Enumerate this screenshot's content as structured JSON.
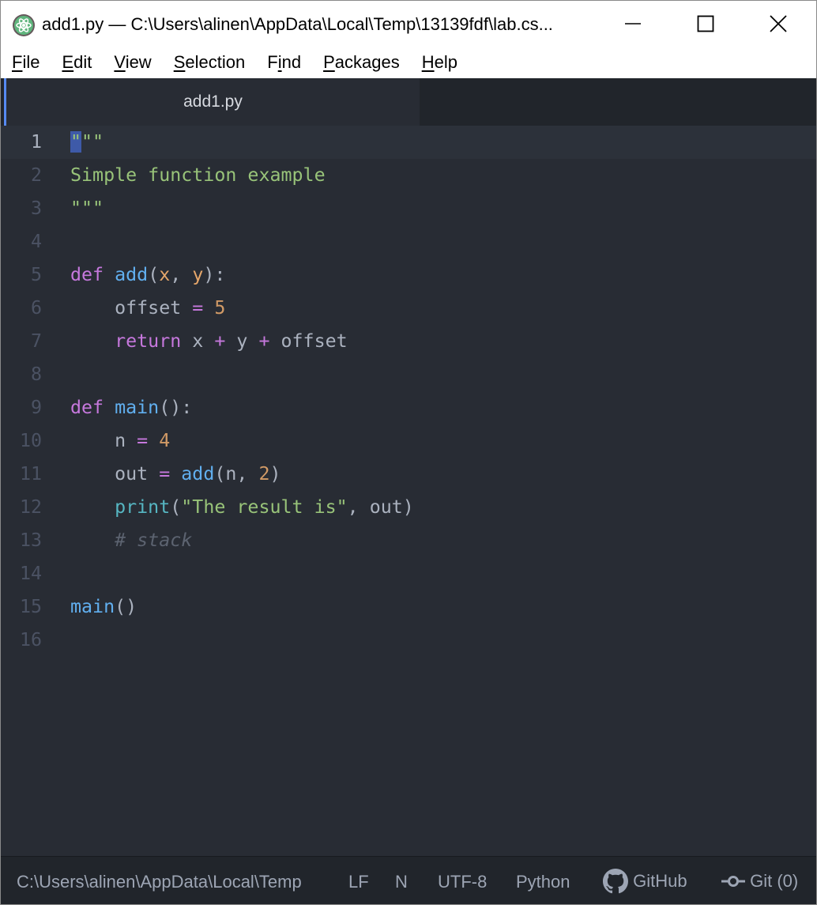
{
  "window": {
    "title": "add1.py — C:\\Users\\alinen\\AppData\\Local\\Temp\\13139fdf\\lab.cs...",
    "app_icon": "atom-icon"
  },
  "menu": [
    "File",
    "Edit",
    "View",
    "Selection",
    "Find",
    "Packages",
    "Help"
  ],
  "tab": {
    "label": "add1.py"
  },
  "editor": {
    "lines": [
      {
        "n": "1",
        "tokens": [
          [
            "sel",
            "\""
          ],
          [
            "s-str",
            "\"\""
          ]
        ]
      },
      {
        "n": "2",
        "tokens": [
          [
            "s-str",
            "Simple function example"
          ]
        ]
      },
      {
        "n": "3",
        "tokens": [
          [
            "s-str",
            "\"\"\""
          ]
        ]
      },
      {
        "n": "4",
        "tokens": []
      },
      {
        "n": "5",
        "tokens": [
          [
            "s-kw",
            "def"
          ],
          [
            "s-tx",
            " "
          ],
          [
            "s-fn",
            "add"
          ],
          [
            "s-tx",
            "("
          ],
          [
            "s-param",
            "x"
          ],
          [
            "s-tx",
            ", "
          ],
          [
            "s-param",
            "y"
          ],
          [
            "s-tx",
            "):"
          ]
        ]
      },
      {
        "n": "6",
        "tokens": [
          [
            "s-tx",
            "    offset "
          ],
          [
            "s-op",
            "="
          ],
          [
            "s-tx",
            " "
          ],
          [
            "s-num",
            "5"
          ]
        ]
      },
      {
        "n": "7",
        "tokens": [
          [
            "s-tx",
            "    "
          ],
          [
            "s-kw",
            "return"
          ],
          [
            "s-tx",
            " x "
          ],
          [
            "s-op",
            "+"
          ],
          [
            "s-tx",
            " y "
          ],
          [
            "s-op",
            "+"
          ],
          [
            "s-tx",
            " offset"
          ]
        ]
      },
      {
        "n": "8",
        "tokens": []
      },
      {
        "n": "9",
        "tokens": [
          [
            "s-kw",
            "def"
          ],
          [
            "s-tx",
            " "
          ],
          [
            "s-fn",
            "main"
          ],
          [
            "s-tx",
            "():"
          ]
        ]
      },
      {
        "n": "10",
        "tokens": [
          [
            "s-tx",
            "    n "
          ],
          [
            "s-op",
            "="
          ],
          [
            "s-tx",
            " "
          ],
          [
            "s-num",
            "4"
          ]
        ]
      },
      {
        "n": "11",
        "tokens": [
          [
            "s-tx",
            "    out "
          ],
          [
            "s-op",
            "="
          ],
          [
            "s-tx",
            " "
          ],
          [
            "s-fn",
            "add"
          ],
          [
            "s-tx",
            "(n, "
          ],
          [
            "s-num",
            "2"
          ],
          [
            "s-tx",
            ")"
          ]
        ]
      },
      {
        "n": "12",
        "tokens": [
          [
            "s-tx",
            "    "
          ],
          [
            "s-bi",
            "print"
          ],
          [
            "s-tx",
            "("
          ],
          [
            "s-str",
            "\"The result is\""
          ],
          [
            "s-tx",
            ", out)"
          ]
        ]
      },
      {
        "n": "13",
        "tokens": [
          [
            "s-tx",
            "    "
          ],
          [
            "s-cm",
            "# stack"
          ]
        ]
      },
      {
        "n": "14",
        "tokens": []
      },
      {
        "n": "15",
        "tokens": [
          [
            "s-fn",
            "main"
          ],
          [
            "s-tx",
            "()"
          ]
        ]
      },
      {
        "n": "16",
        "tokens": []
      }
    ],
    "current_line": "1"
  },
  "status": {
    "path": "C:\\Users\\alinen\\AppData\\Local\\Temp",
    "line_ending": "LF",
    "indicator": "N",
    "encoding": "UTF-8",
    "grammar": "Python",
    "github": "GitHub",
    "git": "Git (0)"
  },
  "colors": {
    "editor_bg": "#282c34",
    "tabbar_bg": "#21252b",
    "tab_accent": "#568af2",
    "string": "#98c379",
    "keyword": "#c678dd",
    "function": "#61afef",
    "number": "#d19a66",
    "builtin": "#56b6c2",
    "comment": "#5c6370"
  }
}
